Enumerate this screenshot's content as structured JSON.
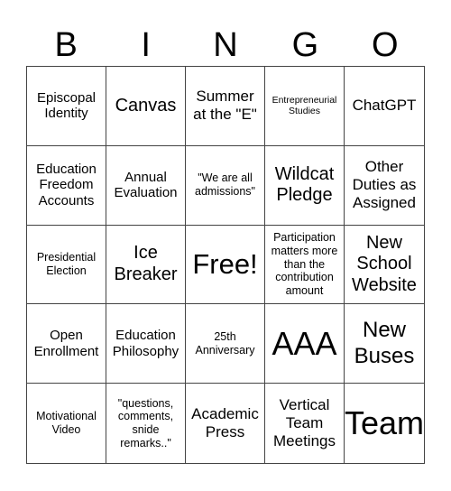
{
  "header": {
    "letters": [
      "B",
      "I",
      "N",
      "G",
      "O"
    ]
  },
  "cells": [
    {
      "text": "Episcopal Identity",
      "size": "s-md"
    },
    {
      "text": "Canvas",
      "size": "s-xl"
    },
    {
      "text": "Summer at the \"E\"",
      "size": "s-lg"
    },
    {
      "text": "Entrepreneurial Studies",
      "size": "s-xs"
    },
    {
      "text": "ChatGPT",
      "size": "s-lg"
    },
    {
      "text": "Education Freedom Accounts",
      "size": "s-md"
    },
    {
      "text": "Annual Evaluation",
      "size": "s-md"
    },
    {
      "text": "\"We are all admissions\"",
      "size": "s-sm"
    },
    {
      "text": "Wildcat Pledge",
      "size": "s-xl"
    },
    {
      "text": "Other Duties as Assigned",
      "size": "s-lg"
    },
    {
      "text": "Presidential Election",
      "size": "s-sm"
    },
    {
      "text": "Ice Breaker",
      "size": "s-xl"
    },
    {
      "text": "Free!",
      "size": "s-free"
    },
    {
      "text": "Participation matters more than the contribution amount",
      "size": "s-sm"
    },
    {
      "text": "New School Website",
      "size": "s-xl"
    },
    {
      "text": "Open Enrollment",
      "size": "s-md"
    },
    {
      "text": "Education Philosophy",
      "size": "s-md"
    },
    {
      "text": "25th Anniversary",
      "size": "s-sm"
    },
    {
      "text": "AAA",
      "size": "s-huge"
    },
    {
      "text": "New Buses",
      "size": "s-xxl"
    },
    {
      "text": "Motivational Video",
      "size": "s-sm"
    },
    {
      "text": "\"questions, comments, snide remarks..\"",
      "size": "s-sm"
    },
    {
      "text": "Academic Press",
      "size": "s-lg"
    },
    {
      "text": "Vertical Team Meetings",
      "size": "s-lg"
    },
    {
      "text": "Team",
      "size": "s-huge"
    }
  ]
}
